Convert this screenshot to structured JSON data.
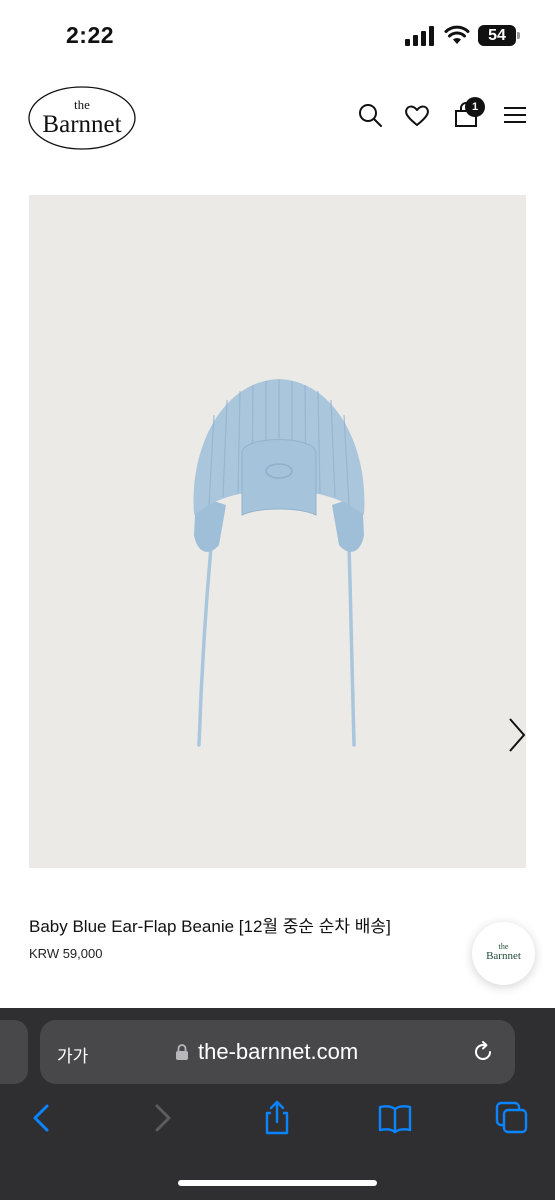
{
  "status_bar": {
    "time": "2:22",
    "battery_level": "54",
    "icons": [
      "cellular-signal-icon",
      "wifi-icon",
      "battery-icon"
    ]
  },
  "header": {
    "logo": {
      "top_text": "the",
      "bottom_text": "Barnnet"
    },
    "icons": [
      "search-icon",
      "heart-icon",
      "shopping-bag-icon",
      "hamburger-menu-icon"
    ],
    "cart_count": "1"
  },
  "product": {
    "image_icon_controls": [
      "chevron-right-icon"
    ],
    "name": "Baby Blue Ear-Flap Beanie [12월 중순 순차 배송]",
    "price": "KRW 59,000"
  },
  "floating_button": {
    "logo": {
      "top_text": "the",
      "bottom_text": "Barnnet"
    }
  },
  "browser": {
    "text_size_label": "가가",
    "url": "the-barnnet.com",
    "icons": [
      "lock-icon",
      "reload-icon",
      "back-icon",
      "forward-icon",
      "share-icon",
      "bookmarks-icon",
      "tabs-icon"
    ]
  },
  "colors": {
    "accent": "#0a84ff",
    "browser_chrome": "#2f2f31",
    "address_bar": "#48484b",
    "image_background": "#eceae6",
    "beanie_blue": "#a9c6dd",
    "floating_logo_green": "#1f4d36"
  }
}
